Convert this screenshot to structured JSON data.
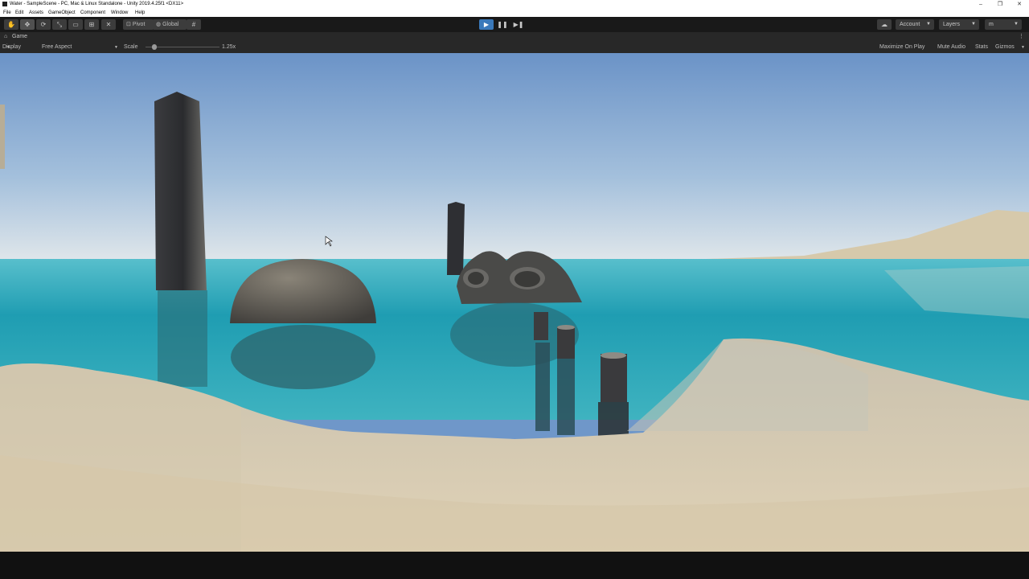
{
  "window": {
    "title": "Water - SampleScene - PC, Mac & Linux Standalone - Unity 2019.4.25f1 <DX11>",
    "controls": [
      "–",
      "❐",
      "✕"
    ]
  },
  "menu": [
    "File",
    "Edit",
    "Assets",
    "GameObject",
    "Component",
    "Window",
    "Help"
  ],
  "toolbar": {
    "tools": [
      "hand-tool-icon",
      "move-tool-icon",
      "rotate-tool-icon",
      "scale-tool-icon",
      "rect-tool-icon",
      "transform-tool-icon",
      "custom-tool-icon"
    ],
    "pivot_label": "Pivot",
    "global_label": "Global",
    "play_state": "playing",
    "account_label": "Account",
    "layers_label": "Layers",
    "layout_label": "m"
  },
  "game_view": {
    "tab_label": "Game",
    "display_label": "Display 1",
    "aspect_label": "Free Aspect",
    "scale_label": "Scale",
    "scale_value": "1.25x",
    "scale_slider_level": 0.1,
    "maximize_label": "Maximize On Play",
    "mute_label": "Mute Audio",
    "stats_label": "Stats",
    "gizmos_label": "Gizmos"
  },
  "colors": {
    "play_active": "#3a79bb",
    "sky_top": "#6f97c9",
    "water": "#2aa3b3",
    "sand": "#d8cbb0"
  }
}
